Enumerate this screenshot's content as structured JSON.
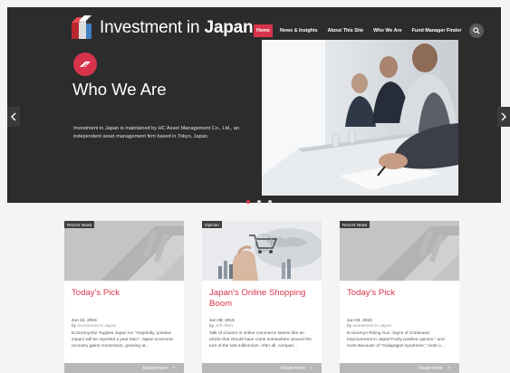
{
  "site": {
    "logo_text_regular": "Investment in ",
    "logo_text_bold": "Japan",
    "brand_color": "#d7344b"
  },
  "nav": {
    "items": [
      {
        "label": "Home",
        "active": true
      },
      {
        "label": "News & Insights",
        "active": false
      },
      {
        "label": "About This Site",
        "active": false
      },
      {
        "label": "Who We Are",
        "active": false
      },
      {
        "label": "Fund Manager Finder",
        "active": false
      }
    ],
    "search_icon": "search-icon"
  },
  "hero": {
    "badge_icon": "arrow-logo-icon",
    "title": "Who We Are",
    "description": "Investment in Japan is maintained by HC Asset Management Co., Ltd., an independent asset management firm based in Tokyo, Japan.",
    "image": "business meeting photo",
    "prev_icon": "chevron-left-icon",
    "next_icon": "chevron-right-icon",
    "slides": 3,
    "active_slide": 1
  },
  "cards": [
    {
      "tag": "Recent News",
      "title": "Today's Pick",
      "date": "Jun 10, 2015",
      "by_label": "by",
      "author": "Investment in Japan",
      "excerpt": "EconomyAbe Topples Japan Inc \"Hopefully, positive impact will be reported a year later.\" Japan economic recovery gains momentum, growing at...",
      "read_more": "Read more"
    },
    {
      "tag": "Opinion",
      "title": "Japan's Online Shopping Boom",
      "date": "Jun 08, 2015",
      "by_label": "by",
      "author": "Jeff Allen",
      "excerpt": "Talk of a boom in online commerce seems like an article that should have come somewhere around the turn of the last millennium. After all, compari...",
      "read_more": "Read more"
    },
    {
      "tag": "Recent News",
      "title": "Today's Pick",
      "date": "Jun 03, 2015",
      "by_label": "by",
      "author": "Investment in Japan",
      "excerpt": "EconomyA Rising Sun: Signs of Continued Improvement in Japan\"Fairly positive opinion.\" and more Because of \"Galapagos syndrome,\" most o...",
      "read_more": "Read more"
    }
  ]
}
